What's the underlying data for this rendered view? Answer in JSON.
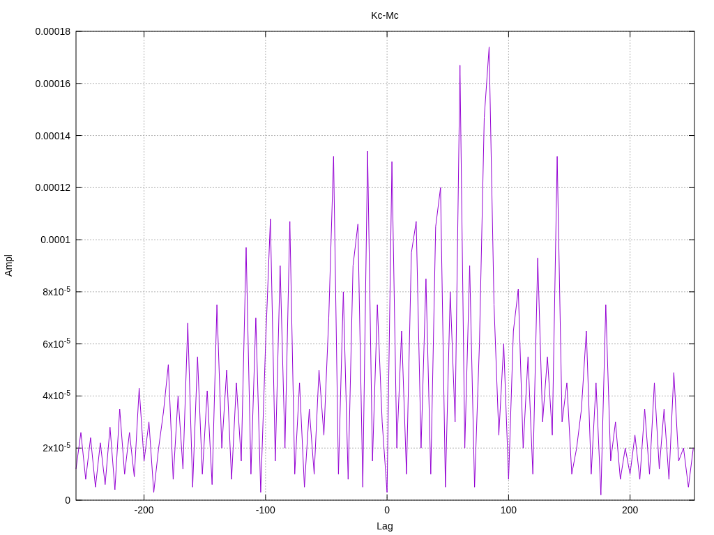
{
  "chart": {
    "chart_data": {
      "type": "line",
      "grid": true,
      "title": "Kc-Mc",
      "xlabel": "Lag",
      "ylabel": "Ampl",
      "xlim": [
        -256,
        253
      ],
      "ylim": [
        0,
        0.00018
      ],
      "xticks": [
        -200,
        -100,
        0,
        100,
        200
      ],
      "yticks": [
        {
          "value": 0,
          "label": "0"
        },
        {
          "value": 2e-05,
          "label": "2x10$^{-5}$"
        },
        {
          "value": 4e-05,
          "label": "4x10$^{-5}$"
        },
        {
          "value": 6e-05,
          "label": "6x10$^{-5}$"
        },
        {
          "value": 8e-05,
          "label": "8x10$^{-5}$"
        },
        {
          "value": 0.0001,
          "label": "0.0001"
        },
        {
          "value": 0.00012,
          "label": "0.00012"
        },
        {
          "value": 0.00014,
          "label": "0.00014"
        },
        {
          "value": 0.00016,
          "label": "0.00016"
        },
        {
          "value": 0.00018,
          "label": "0.00018"
        }
      ],
      "x": [
        -256,
        -252,
        -248,
        -244,
        -240,
        -236,
        -232,
        -228,
        -224,
        -220,
        -216,
        -212,
        -208,
        -204,
        -200,
        -196,
        -192,
        -188,
        -184,
        -180,
        -176,
        -172,
        -168,
        -164,
        -160,
        -156,
        -152,
        -148,
        -144,
        -140,
        -136,
        -132,
        -128,
        -124,
        -120,
        -116,
        -112,
        -108,
        -104,
        -100,
        -96,
        -92,
        -88,
        -84,
        -80,
        -76,
        -72,
        -68,
        -64,
        -60,
        -56,
        -52,
        -48,
        -44,
        -40,
        -36,
        -32,
        -28,
        -24,
        -20,
        -16,
        -12,
        -8,
        -4,
        0,
        4,
        8,
        12,
        16,
        20,
        24,
        28,
        32,
        36,
        40,
        44,
        48,
        52,
        56,
        60,
        64,
        68,
        72,
        76,
        80,
        84,
        88,
        92,
        96,
        100,
        104,
        108,
        112,
        116,
        120,
        124,
        128,
        132,
        136,
        140,
        144,
        148,
        152,
        156,
        160,
        164,
        168,
        172,
        176,
        180,
        184,
        188,
        192,
        196,
        200,
        204,
        208,
        212,
        216,
        220,
        224,
        228,
        232,
        236,
        240,
        244,
        248,
        252
      ],
      "series": [
        {
          "color": "#9400d3",
          "values": [
            1.2e-05,
            2.6e-05,
            8e-06,
            2.4e-05,
            5e-06,
            2.2e-05,
            6e-06,
            2.8e-05,
            4e-06,
            3.5e-05,
            1e-05,
            2.6e-05,
            9e-06,
            4.3e-05,
            1.5e-05,
            3e-05,
            3e-06,
            2e-05,
            3.4e-05,
            5.2e-05,
            8e-06,
            4e-05,
            1.2e-05,
            6.8e-05,
            5e-06,
            5.5e-05,
            1e-05,
            4.2e-05,
            6e-06,
            7.5e-05,
            2e-05,
            5e-05,
            8e-06,
            4.5e-05,
            1.5e-05,
            9.7e-05,
            1e-05,
            7e-05,
            3e-06,
            6e-05,
            0.000108,
            1.5e-05,
            9e-05,
            2e-05,
            0.000107,
            1e-05,
            4.5e-05,
            5e-06,
            3.5e-05,
            1e-05,
            5e-05,
            2.5e-05,
            7e-05,
            0.000132,
            1e-05,
            8e-05,
            8e-06,
            9e-05,
            0.000106,
            5e-06,
            0.000134,
            1.5e-05,
            7.5e-05,
            3e-05,
            3e-06,
            0.00013,
            2e-05,
            6.5e-05,
            1e-05,
            9.5e-05,
            0.000107,
            2e-05,
            8.5e-05,
            1e-05,
            0.000105,
            0.00012,
            5e-06,
            8e-05,
            3e-05,
            0.000167,
            2e-05,
            9e-05,
            5e-06,
            6e-05,
            0.000147,
            0.000174,
            7.5e-05,
            2.5e-05,
            6e-05,
            8e-06,
            6.5e-05,
            8.1e-05,
            2e-05,
            5.5e-05,
            1e-05,
            9.3e-05,
            3e-05,
            5.5e-05,
            2.5e-05,
            0.000132,
            3e-05,
            4.5e-05,
            1e-05,
            2e-05,
            3.5e-05,
            6.5e-05,
            1e-05,
            4.5e-05,
            2e-06,
            7.5e-05,
            1.5e-05,
            3e-05,
            8e-06,
            2e-05,
            1e-05,
            2.5e-05,
            8e-06,
            3.5e-05,
            1e-05,
            4.5e-05,
            1.2e-05,
            3.5e-05,
            8e-06,
            4.9e-05,
            1.5e-05,
            2e-05,
            5e-06,
            2e-05
          ]
        }
      ]
    }
  }
}
